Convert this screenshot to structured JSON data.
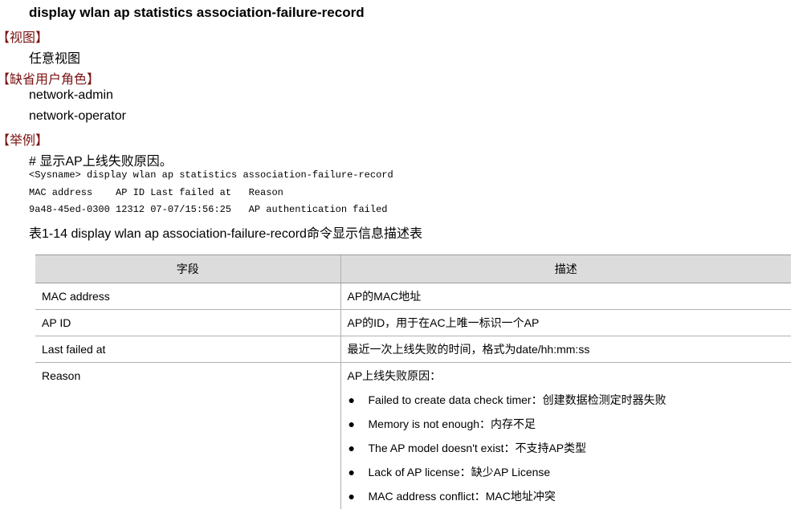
{
  "command_title": "display wlan ap statistics association-failure-record",
  "sections": {
    "view_label": "【视图】",
    "view_value": "任意视图",
    "role_label": "【缺省用户角色】",
    "role_values": [
      "network-admin",
      "network-operator"
    ],
    "example_label": "【举例】",
    "example_comment": "# 显示AP上线失败原因。"
  },
  "code_lines": [
    "<Sysname> display wlan ap statistics association-failure-record",
    "MAC address    AP ID Last failed at   Reason",
    "9a48-45ed-0300 12312 07-07/15:56:25   AP authentication failed"
  ],
  "table": {
    "caption": "表1-14 display wlan ap association-failure-record命令显示信息描述表",
    "headers": [
      "字段",
      "描述"
    ],
    "rows": [
      {
        "field": "MAC address",
        "desc": "AP的MAC地址"
      },
      {
        "field": "AP ID",
        "desc": "AP的ID，用于在AC上唯一标识一个AP"
      },
      {
        "field": "Last failed at",
        "desc": "最近一次上线失败的时间，格式为date/hh:mm:ss"
      }
    ],
    "reason_row": {
      "field": "Reason",
      "intro": "AP上线失败原因：",
      "bullet": "●",
      "items": [
        "Failed to create data check timer：创建数据检测定时器失败",
        "Memory is not enough：内存不足",
        "The AP model doesn't exist：不支持AP类型",
        "Lack of AP license：缺少AP License",
        "MAC address conflict：MAC地址冲突"
      ]
    }
  }
}
